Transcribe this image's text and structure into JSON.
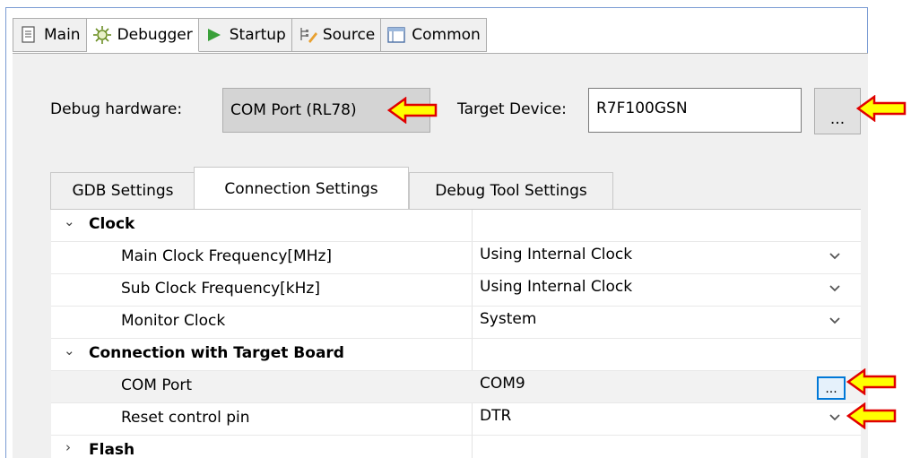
{
  "top_tabs": [
    {
      "label": "Main",
      "icon": "page-icon"
    },
    {
      "label": "Debugger",
      "icon": "bug-gear-icon"
    },
    {
      "label": "Startup",
      "icon": "play-icon"
    },
    {
      "label": "Source",
      "icon": "source-tree-icon"
    },
    {
      "label": "Common",
      "icon": "window-icon"
    }
  ],
  "active_top_tab": "Debugger",
  "debug_hardware": {
    "label": "Debug hardware:",
    "value": "COM Port (RL78)"
  },
  "target_device": {
    "label": "Target Device:",
    "value": "R7F100GSN",
    "browse_label": "..."
  },
  "sub_tabs": [
    "GDB Settings",
    "Connection Settings",
    "Debug Tool Settings"
  ],
  "active_sub_tab": "Connection Settings",
  "groups": {
    "clock": {
      "label": "Clock",
      "rows": [
        {
          "name": "Main Clock Frequency[MHz]",
          "value": "Using Internal Clock"
        },
        {
          "name": "Sub Clock Frequency[kHz]",
          "value": "Using Internal Clock"
        },
        {
          "name": "Monitor Clock",
          "value": "System"
        }
      ]
    },
    "connection": {
      "label": "Connection with Target Board",
      "rows": [
        {
          "name": "COM Port",
          "value": "COM9",
          "button_label": "..."
        },
        {
          "name": "Reset control pin",
          "value": "DTR"
        }
      ]
    },
    "flash": {
      "label": "Flash"
    }
  },
  "colors": {
    "callout_arrow_fill": "#ffff00",
    "callout_arrow_stroke": "#e00000",
    "selection_border": "#0078d7"
  }
}
